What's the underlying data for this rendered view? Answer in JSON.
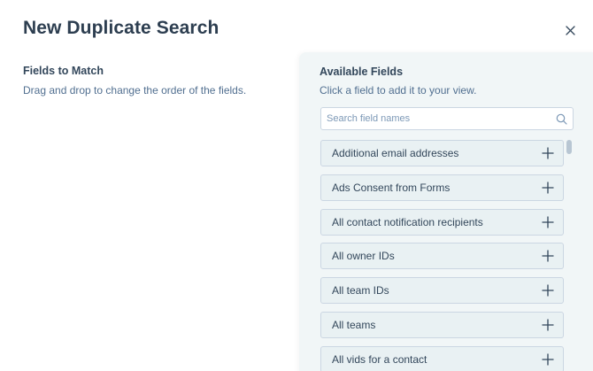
{
  "dialog": {
    "title": "New Duplicate Search",
    "close_icon": "close-icon"
  },
  "left": {
    "heading": "Fields to Match",
    "subtext": "Drag and drop to change the order of the fields."
  },
  "right": {
    "heading": "Available Fields",
    "subtext": "Click a field to add it to your view.",
    "search": {
      "placeholder": "Search field names",
      "value": "",
      "icon": "search-icon"
    },
    "fields": [
      {
        "label": "Additional email addresses",
        "icon": "plus-icon"
      },
      {
        "label": "Ads Consent from Forms",
        "icon": "plus-icon"
      },
      {
        "label": "All contact notification recipients",
        "icon": "plus-icon"
      },
      {
        "label": "All owner IDs",
        "icon": "plus-icon"
      },
      {
        "label": "All team IDs",
        "icon": "plus-icon"
      },
      {
        "label": "All teams",
        "icon": "plus-icon"
      },
      {
        "label": "All vids for a contact",
        "icon": "plus-icon"
      }
    ]
  },
  "colors": {
    "title": "#2d3e50",
    "text": "#33475b",
    "subtext": "#516f90",
    "panel_bg": "#f1f6f7",
    "field_bg": "#e9f1f3",
    "border": "#cbd6e2"
  }
}
